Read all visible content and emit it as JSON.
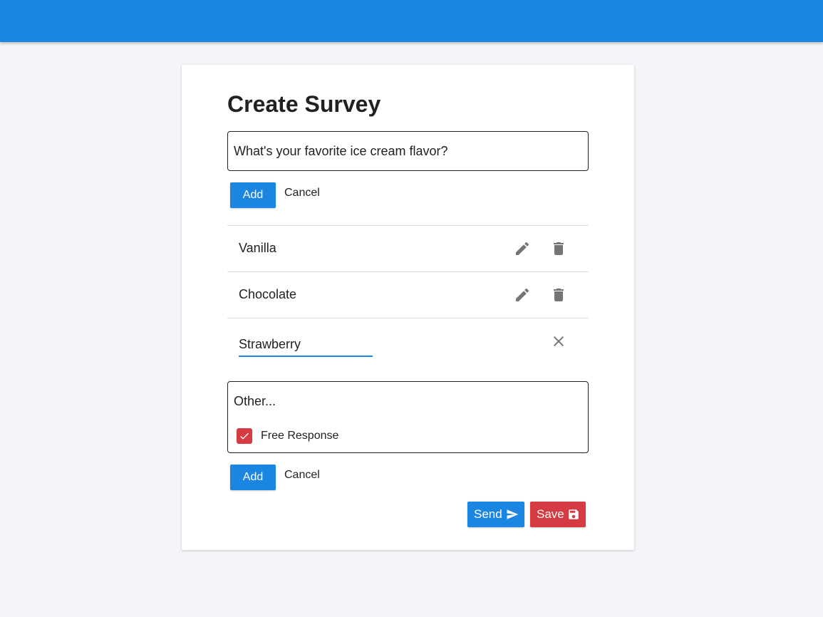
{
  "survey": {
    "title": "Create Survey",
    "question_value": "What's your favorite ice cream flavor?",
    "add_label": "Add",
    "cancel_label": "Cancel"
  },
  "options": [
    {
      "label": "Vanilla"
    },
    {
      "label": "Chocolate"
    }
  ],
  "editing_option": {
    "value": "Strawberry"
  },
  "other": {
    "value": "Other...",
    "free_response_label": "Free Response",
    "free_response_checked": true,
    "add_label": "Add",
    "cancel_label": "Cancel"
  },
  "actions": {
    "send_label": "Send",
    "save_label": "Save"
  },
  "colors": {
    "primary": "#1a86e2",
    "danger": "#d63a43",
    "icon_gray": "#757575"
  },
  "icons": [
    "edit-icon",
    "delete-icon",
    "close-icon",
    "checkbox-checked-icon",
    "send-icon",
    "save-icon"
  ]
}
